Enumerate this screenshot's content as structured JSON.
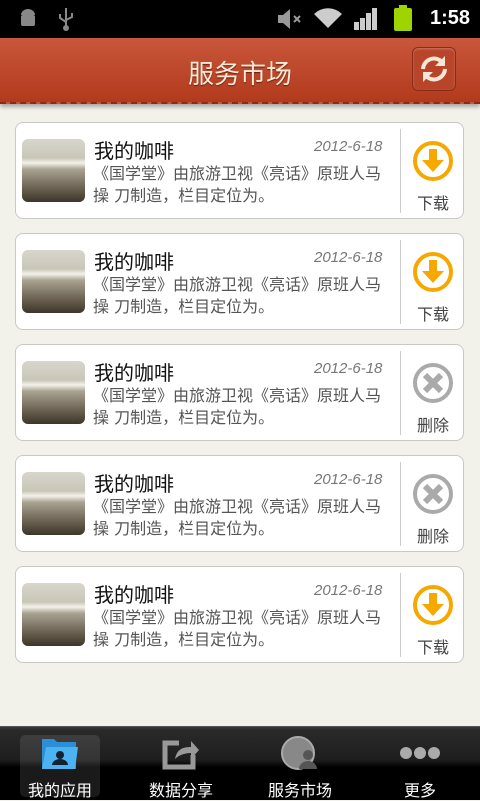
{
  "status_bar": {
    "time": "1:58",
    "icons": [
      "android-icon",
      "usb-icon",
      "mute-icon",
      "wifi-icon",
      "signal-icon",
      "battery-icon"
    ],
    "battery_color": "#9fd400"
  },
  "header": {
    "title": "服务市场",
    "refresh_icon": "refresh-icon",
    "bg_color": "#c04a2c"
  },
  "items": [
    {
      "name": "我的咖啡",
      "date": "2012-6-18",
      "desc": "《国学堂》由旅游卫视《亮话》原班人马 操 刀制造，栏目定位为。",
      "action": "下载",
      "action_type": "download"
    },
    {
      "name": "我的咖啡",
      "date": "2012-6-18",
      "desc": "《国学堂》由旅游卫视《亮话》原班人马 操 刀制造，栏目定位为。",
      "action": "下载",
      "action_type": "download"
    },
    {
      "name": "我的咖啡",
      "date": "2012-6-18",
      "desc": "《国学堂》由旅游卫视《亮话》原班人马 操 刀制造，栏目定位为。",
      "action": "删除",
      "action_type": "delete"
    },
    {
      "name": "我的咖啡",
      "date": "2012-6-18",
      "desc": "《国学堂》由旅游卫视《亮话》原班人马 操 刀制造，栏目定位为。",
      "action": "删除",
      "action_type": "delete"
    },
    {
      "name": "我的咖啡",
      "date": "2012-6-18",
      "desc": "《国学堂》由旅游卫视《亮话》原班人马 操 刀制造，栏目定位为。",
      "action": "下载",
      "action_type": "download"
    }
  ],
  "colors": {
    "download": "#f5a800",
    "delete": "#aaaaaa"
  },
  "tabs": [
    {
      "label": "我的应用",
      "icon": "folder-user-icon",
      "selected": true
    },
    {
      "label": "数据分享",
      "icon": "share-icon",
      "selected": false
    },
    {
      "label": "服务市场",
      "icon": "globe-user-icon",
      "selected": false
    },
    {
      "label": "更多",
      "icon": "more-icon",
      "selected": false
    }
  ]
}
